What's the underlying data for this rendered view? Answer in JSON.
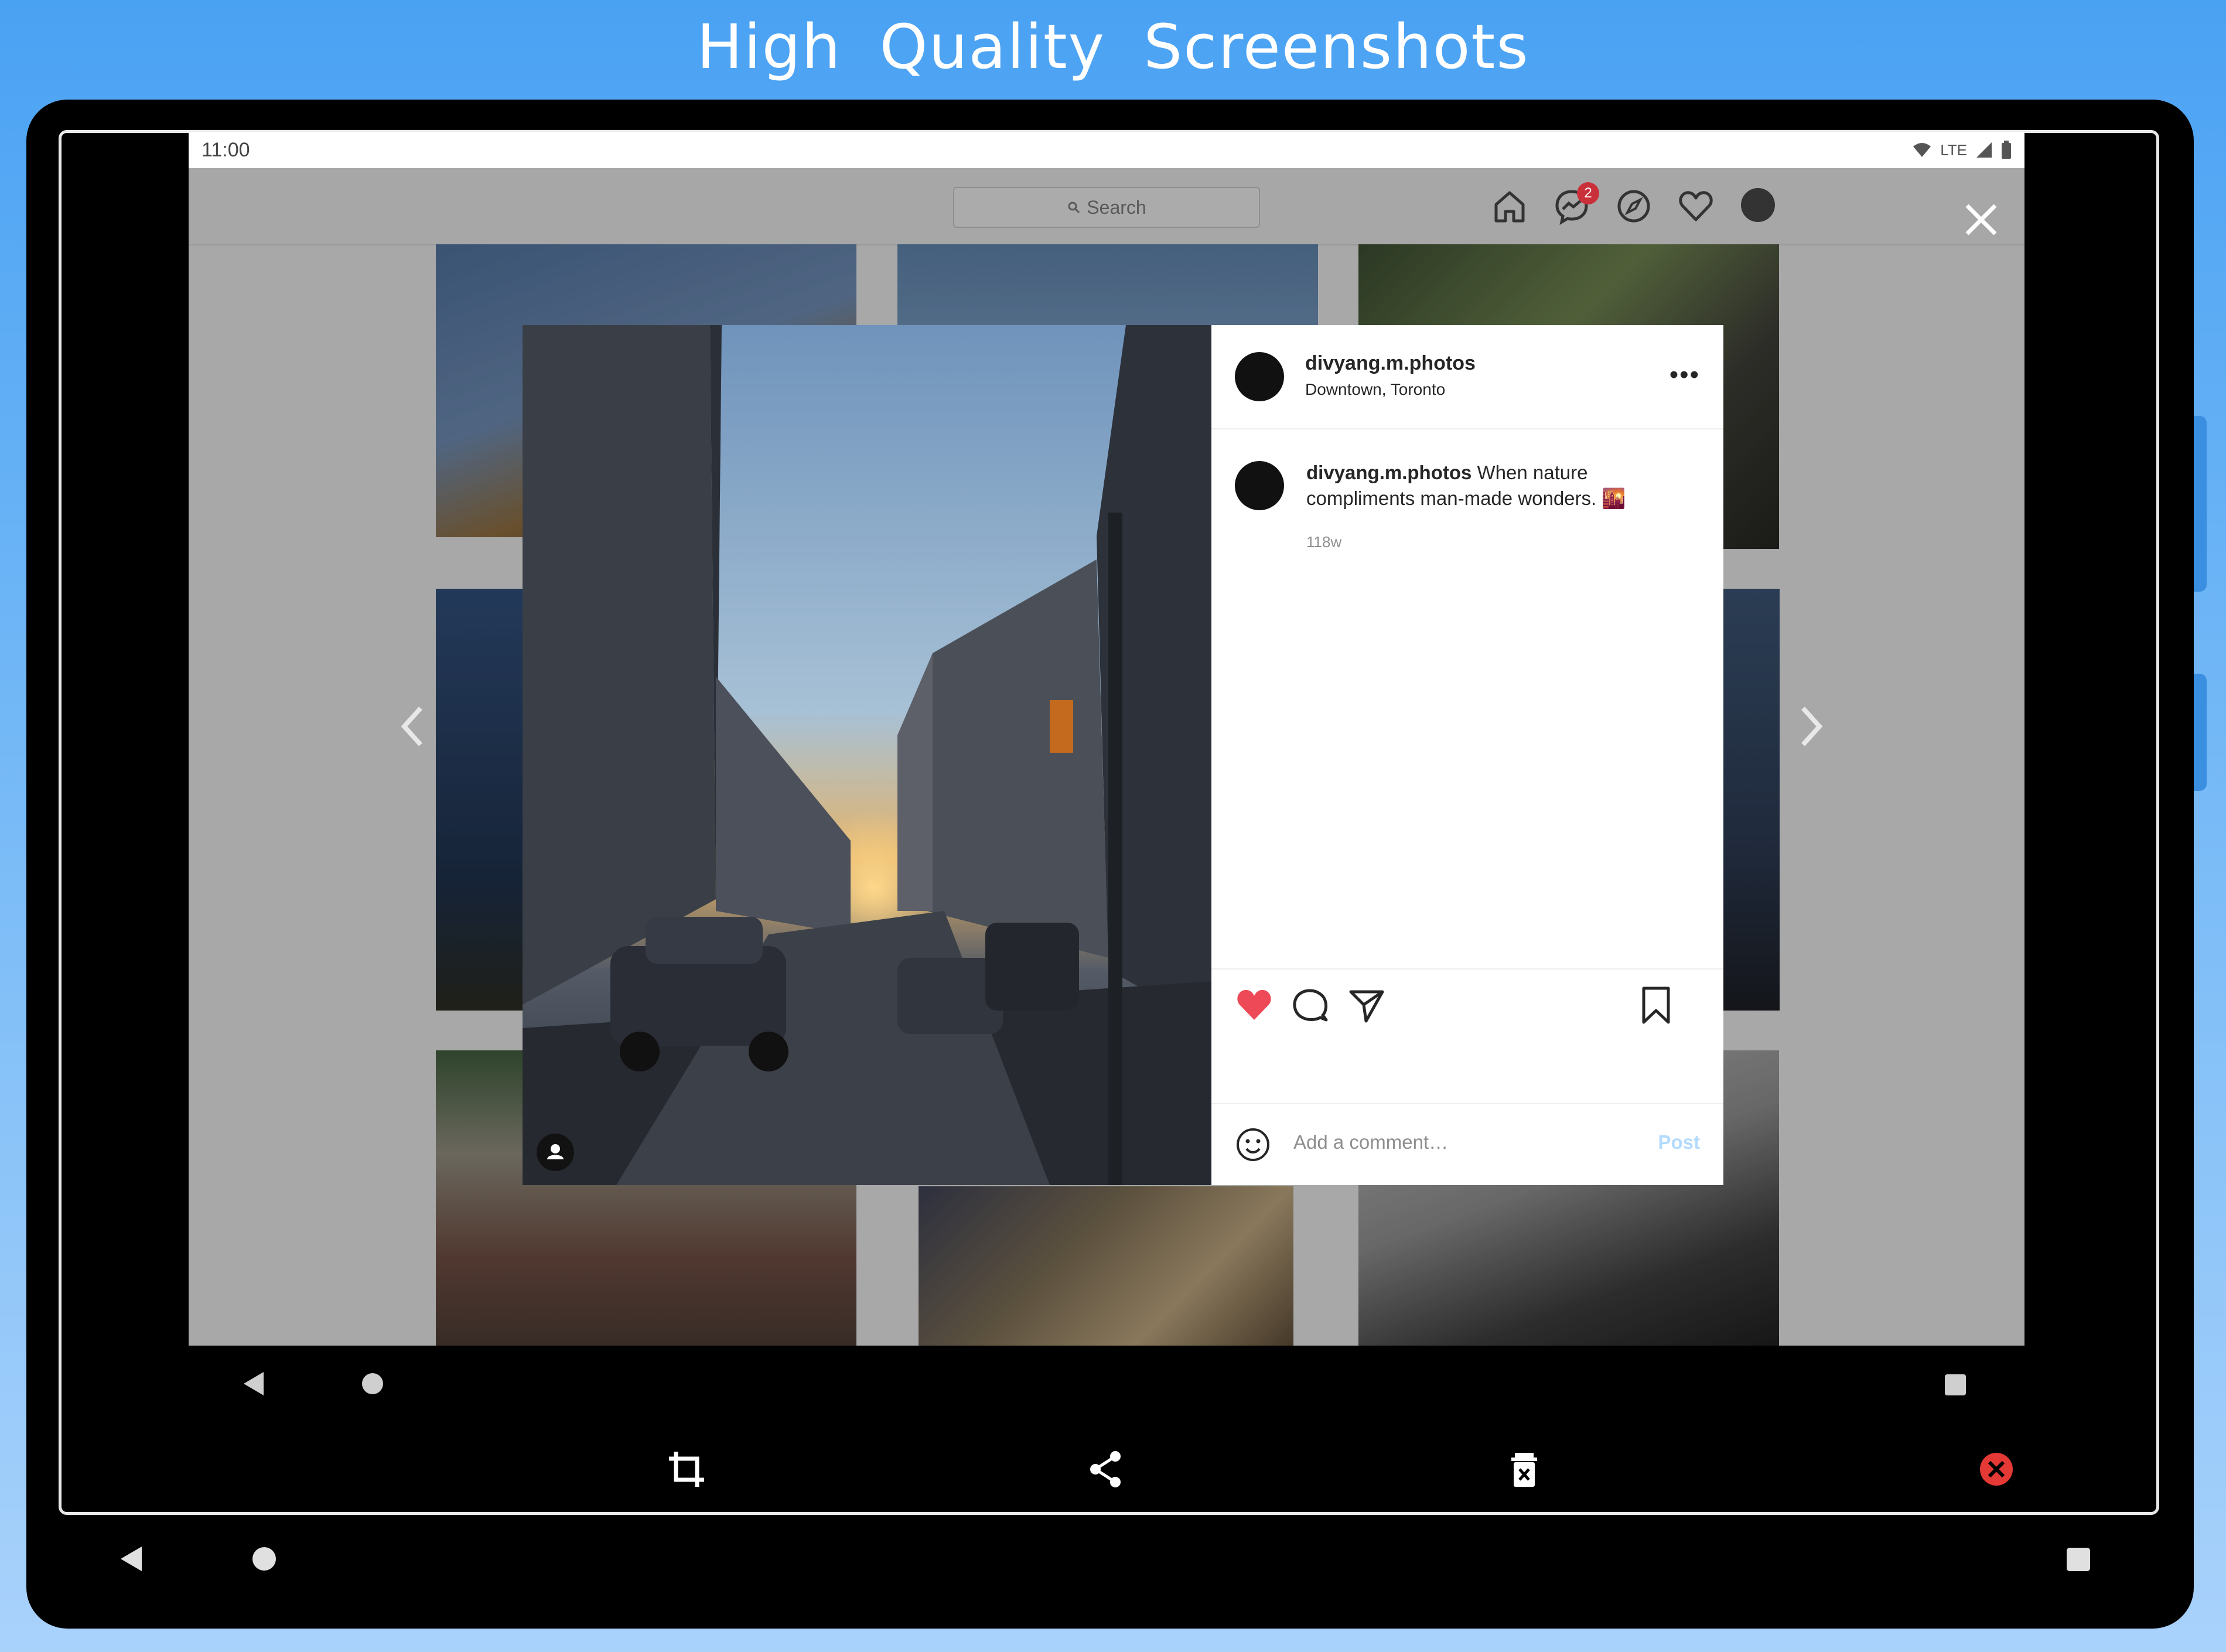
{
  "banner": {
    "title": "High  Quality Screenshots"
  },
  "status_bar": {
    "time": "11:00",
    "network": "LTE"
  },
  "app_topbar": {
    "search_placeholder": "Search",
    "notification_count": "2",
    "icons": [
      "home-icon",
      "messenger-icon",
      "explore-icon",
      "heart-icon",
      "profile-avatar"
    ]
  },
  "post": {
    "username": "divyang.m.photos",
    "location": "Downtown, Toronto",
    "more_label": "•••",
    "caption_username": "divyang.m.photos",
    "caption_text": "When nature compliments man-made wonders. 🌇",
    "age": "118w",
    "comment_placeholder": "Add a comment…",
    "post_label": "Post",
    "liked": true
  },
  "android_nav": [
    "back",
    "home",
    "recents"
  ],
  "editor_toolbar": [
    "crop-icon",
    "share-icon",
    "delete-icon",
    "cancel-icon"
  ],
  "colors": {
    "banner_bg": "#4aa2f3",
    "like_red": "#ed4956",
    "post_button": "#b3dbff",
    "badge": "#c9303a",
    "cancel_red": "#e53935"
  }
}
